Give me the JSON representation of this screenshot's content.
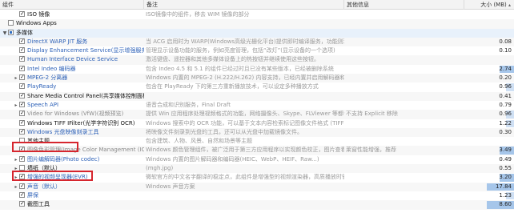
{
  "columns": {
    "name": "组件",
    "description": "备注",
    "info": "其他信息",
    "size": "大小 (MB)",
    "size_sort_icon": "sort-icon"
  },
  "rows": [
    {
      "level": 1,
      "expander": "",
      "check": "on",
      "name": "ISO 镜像",
      "name_style": "dark",
      "desc": "ISO镜像中的组件，移去 WIM 镜像的部分",
      "info": "",
      "size": "",
      "bar": 0
    },
    {
      "level": 0,
      "expander": "",
      "check": "off",
      "name": "Windows Apps",
      "name_style": "dark",
      "desc": "",
      "info": "",
      "size": "",
      "bar": 0
    },
    {
      "level": 0,
      "expander": "▼",
      "check": "partial",
      "name": "多媒体",
      "name_style": "dark",
      "desc": "",
      "info": "",
      "size": "",
      "bar": 0,
      "selected": true
    },
    {
      "level": 1,
      "expander": "",
      "check": "on",
      "name": "DirectX WARP JIT 服务",
      "name_style": "blue",
      "desc": "当 ACG 启用时为 WARP(Windows高级光栅化平台)提供即时编译服务，功能则现实有用。",
      "info": "",
      "size": "0.08",
      "bar": 0
    },
    {
      "level": 1,
      "expander": "",
      "check": "on",
      "name": "Display Enhancement Service(显示增强服务)",
      "name_style": "blue",
      "desc": "管理显示设备功能的服务，例如亮度管理，包括“改灯”(显示设备的一个选项)",
      "info": "",
      "size": "0.10",
      "bar": 0
    },
    {
      "level": 1,
      "expander": "",
      "check": "on",
      "name": "Human Interface Device Service",
      "name_style": "blue",
      "desc": "激活键盘、遥控器和其他多媒体设备上的热按钮并继续使用这些按钮。",
      "info": "",
      "size": "",
      "bar": 0
    },
    {
      "level": 1,
      "expander": "",
      "check": "on",
      "name": "Intel Indeo 编码器",
      "name_style": "blue",
      "desc": "包含 Indeo 4.5 和 5.1 的组件已经过时且已没有某些版本，已经被删除系统",
      "info": "",
      "size": "2.74",
      "bar": 2
    },
    {
      "level": 1,
      "expander": "▸",
      "check": "on",
      "name": "MPEG-2 分离器",
      "name_style": "blue",
      "desc": "Windows 内置的 MPEG-2 (H.222/H.262) 内容支持，已经内置并启用解码器和编码器的。",
      "info": "",
      "size": "0.20",
      "bar": 0
    },
    {
      "level": 1,
      "expander": "",
      "check": "on",
      "name": "PlayReady",
      "name_style": "blue",
      "desc": "包含在 PlayReady 下的第三方重新播放技术，可以设定多种播放方式",
      "info": "",
      "size": "0.96",
      "bar": 1
    },
    {
      "level": 1,
      "expander": "",
      "check": "on",
      "name": "Share Media Control Panel(共享媒体控制面板)",
      "name_style": "dark",
      "desc": "",
      "info": "",
      "size": "0.41",
      "bar": 0
    },
    {
      "level": 1,
      "expander": "▸",
      "check": "on",
      "name": "Speech API",
      "name_style": "blue",
      "desc": "语音合成和识别服务，Final Draft",
      "info": "",
      "size": "0.79",
      "bar": 0
    },
    {
      "level": 1,
      "expander": "",
      "check": "on",
      "name": "Video for Windows (VfW)(视频预览)",
      "name_style": "gray",
      "desc": "提供 Win 应用程序处理视频格式的功能，网络摄像头、Skype、FLViewer 等都依赖此系统。",
      "info": "不支持 Explicit 移除",
      "size": "0.96",
      "bar": 1
    },
    {
      "level": 1,
      "expander": "",
      "check": "on",
      "name": "Windows TIFF IFilter(光学字符识别 OCR)",
      "name_style": "dark",
      "desc": "Windows 搜索中的 OCR 功能，可以基于文本内容检索标记图像文件格式 (TIFF) 文档",
      "info": "",
      "size": "1.22",
      "bar": 1
    },
    {
      "level": 1,
      "expander": "",
      "check": "on",
      "name": "Windows 光盘映像刻录工具",
      "name_style": "blue",
      "desc": "将映像文件刻录到光盘的工具，还可以从光盘中加载镜像文件。",
      "info": "",
      "size": "0.30",
      "bar": 0
    },
    {
      "level": 1,
      "expander": "",
      "check": "off",
      "name": "其他主题",
      "name_style": "dark",
      "desc": "包含建筑、人物、风景、自然和场景等主题",
      "info": "",
      "size": "",
      "bar": 0
    },
    {
      "level": 1,
      "expander": "",
      "check": "on",
      "name": "图像色彩管理(Image Color Management (ICM))",
      "name_style": "gray",
      "desc": "Windows 颜色管理组件，被广泛用于第三方应用程序以实现颜色校正，图片查看与编辑程序。",
      "info": "莱窗性能增强，推荐",
      "size": "3.49",
      "bar": 2
    },
    {
      "level": 1,
      "expander": "▸",
      "check": "on",
      "name": "图片编解码器(Photo codec)",
      "name_style": "blue",
      "desc": "Windows 内置的图片解码器和编码器(HEIC、WebP、HEIF、Raw...)",
      "info": "",
      "size": "0.49",
      "bar": 0
    },
    {
      "level": 1,
      "expander": "▸",
      "check": "off",
      "name": "墙纸（默认）",
      "name_style": "dark",
      "desc": "(mgh.jpg)",
      "info": "",
      "size": "0.55",
      "bar": 0
    },
    {
      "level": 1,
      "expander": "▸",
      "check": "on",
      "name": "增强的视频呈现器(EVR)",
      "name_style": "blue",
      "desc": "微软官方的中文名字翻译的稳定点，此组件是增强型的视频渲染器，高质播放时需要使用。",
      "info": "",
      "size": "3.20",
      "bar": 2
    },
    {
      "level": 1,
      "expander": "▸",
      "check": "on",
      "name": "声音（默认）",
      "name_style": "blue",
      "desc": "Windows 声音方案",
      "info": "",
      "size": "17.84",
      "bar": 3
    },
    {
      "level": 1,
      "expander": "",
      "check": "on",
      "name": "屏保",
      "name_style": "blue",
      "desc": "",
      "info": "",
      "size": "1.23",
      "bar": 1
    },
    {
      "level": 1,
      "expander": "",
      "check": "on",
      "name": "截图工具",
      "name_style": "dark",
      "desc": "",
      "info": "",
      "size": "8.60",
      "bar": 3
    }
  ],
  "colors": {
    "highlight_box": "#d6262e",
    "bar_big": "#a6c6ea",
    "bar_mid": "#cfe0f4",
    "link_blue": "#2e62b8"
  }
}
